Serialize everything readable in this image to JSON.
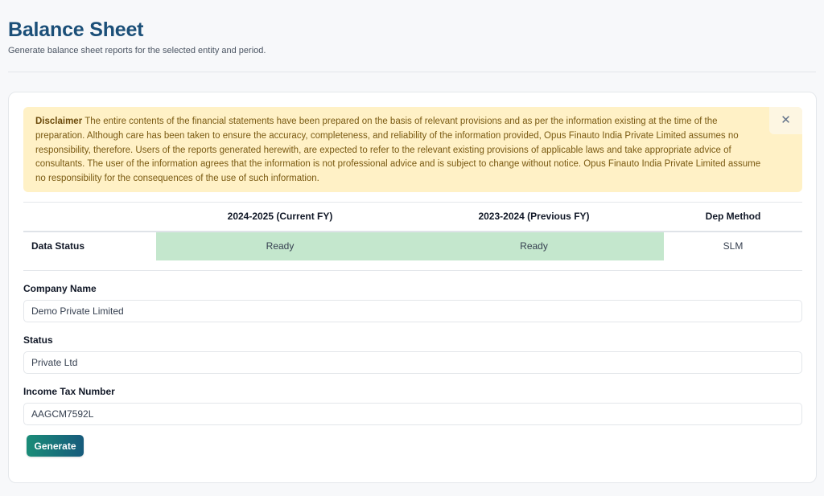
{
  "page": {
    "title": "Balance Sheet",
    "subtitle": "Generate balance sheet reports for the selected entity and period."
  },
  "disclaimer": {
    "label": "Disclaimer",
    "text": "The entire contents of the financial statements have been prepared on the basis of relevant provisions and as per the information existing at the time of the preparation. Although care has been taken to ensure the accuracy, completeness, and reliability of the information provided, Opus Finauto India Private Limited assumes no responsibility, therefore. Users of the reports generated herewith, are expected to refer to the relevant existing provisions of applicable laws and take appropriate advice of consultants. The user of the information agrees that the information is not professional advice and is subject to change without notice. Opus Finauto India Private Limited assume no responsibility for the consequences of the use of such information.",
    "close_icon": "close-icon",
    "close_glyph": "✕"
  },
  "status_table": {
    "headers": [
      "",
      "2024-2025 (Current FY)",
      "2023-2024 (Previous FY)",
      "Dep Method"
    ],
    "row": {
      "label": "Data Status",
      "current_fy": "Ready",
      "previous_fy": "Ready",
      "dep_method": "SLM"
    },
    "ready_color": "#c4e7cd"
  },
  "form": {
    "company_name": {
      "label": "Company Name",
      "value": "Demo Private Limited"
    },
    "status": {
      "label": "Status",
      "value": "Private Ltd"
    },
    "income_tax_number": {
      "label": "Income Tax Number",
      "value": "AAGCM7592L"
    },
    "generate_label": "Generate"
  },
  "colors": {
    "title": "#1b4f78",
    "disclaimer_bg": "#fff1c6",
    "button_gradient_start": "#1a8c78",
    "button_gradient_end": "#175b7c"
  }
}
